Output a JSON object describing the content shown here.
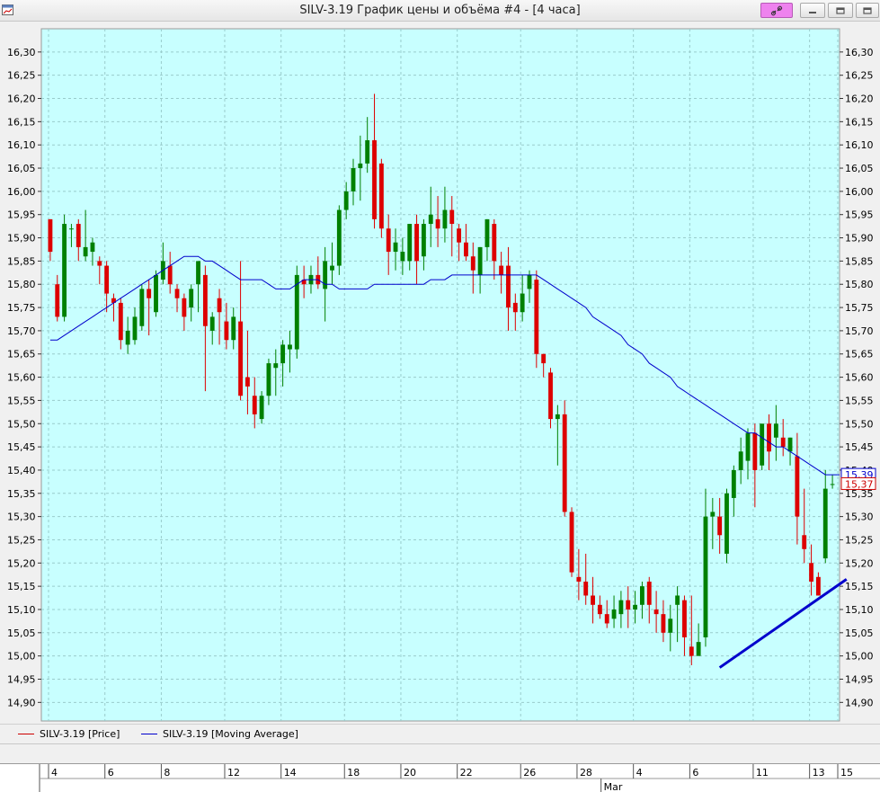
{
  "window": {
    "title": "SILV-3.19 График цены и объёма #4 - [4 часа]"
  },
  "legend": {
    "price_label": "SILV-3.19 [Price]",
    "ma_label": "SILV-3.19 [Moving Average]",
    "price_color": "#cc0000",
    "ma_color": "#0000cc"
  },
  "icons": {
    "app": "chart-window-icon",
    "link": "link-icon",
    "min": "minimize-icon",
    "max": "restore-icon",
    "close": "close-icon"
  },
  "colors": {
    "plot_bg": "#c8ffff",
    "bull": "#008000",
    "bear": "#dd0000",
    "trendline": "#0000cc",
    "ma": "#0000cc"
  },
  "chart_data": {
    "type": "candlestick",
    "y_axis": {
      "min": 14.86,
      "max": 16.35,
      "step": 0.05,
      "side": "both",
      "decimal_separator": ","
    },
    "current_price_labels": [
      {
        "value": 15.39,
        "text": "15,39",
        "color": "#0000cc"
      },
      {
        "value": 15.37,
        "text": "15,37",
        "color": "#cc0000"
      }
    ],
    "grid": true,
    "x_ticks": [
      "4",
      "6",
      "8",
      "12",
      "14",
      "18",
      "20",
      "22",
      "26",
      "28",
      "4",
      "6",
      "11",
      "13",
      "15"
    ],
    "x_month_label": "Mar",
    "series": [
      {
        "name": "SILV-3.19 [Price]",
        "kind": "ohlc",
        "values": [
          [
            15.94,
            15.94,
            15.85,
            15.87
          ],
          [
            15.8,
            15.82,
            15.72,
            15.73
          ],
          [
            15.73,
            15.95,
            15.72,
            15.93
          ],
          [
            15.92,
            15.93,
            15.88,
            15.92
          ],
          [
            15.93,
            15.94,
            15.85,
            15.88
          ],
          [
            15.86,
            15.96,
            15.85,
            15.88
          ],
          [
            15.87,
            15.9,
            15.84,
            15.89
          ],
          [
            15.85,
            15.86,
            15.8,
            15.84
          ],
          [
            15.84,
            15.85,
            15.74,
            15.78
          ],
          [
            15.77,
            15.78,
            15.72,
            15.76
          ],
          [
            15.76,
            15.77,
            15.66,
            15.68
          ],
          [
            15.67,
            15.73,
            15.65,
            15.7
          ],
          [
            15.68,
            15.75,
            15.67,
            15.73
          ],
          [
            15.71,
            15.8,
            15.7,
            15.79
          ],
          [
            15.79,
            15.81,
            15.69,
            15.77
          ],
          [
            15.74,
            15.83,
            15.73,
            15.82
          ],
          [
            15.81,
            15.89,
            15.8,
            15.85
          ],
          [
            15.84,
            15.87,
            15.78,
            15.8
          ],
          [
            15.79,
            15.8,
            15.74,
            15.77
          ],
          [
            15.77,
            15.78,
            15.7,
            15.73
          ],
          [
            15.75,
            15.8,
            15.72,
            15.79
          ],
          [
            15.8,
            15.84,
            15.74,
            15.85
          ],
          [
            15.82,
            15.84,
            15.57,
            15.71
          ],
          [
            15.7,
            15.74,
            15.67,
            15.73
          ],
          [
            15.77,
            15.79,
            15.67,
            15.74
          ],
          [
            15.72,
            15.76,
            15.66,
            15.68
          ],
          [
            15.68,
            15.75,
            15.66,
            15.73
          ],
          [
            15.72,
            15.85,
            15.55,
            15.56
          ],
          [
            15.6,
            15.7,
            15.52,
            15.58
          ],
          [
            15.56,
            15.6,
            15.49,
            15.52
          ],
          [
            15.51,
            15.57,
            15.5,
            15.56
          ],
          [
            15.56,
            15.64,
            15.54,
            15.63
          ],
          [
            15.62,
            15.66,
            15.56,
            15.63
          ],
          [
            15.63,
            15.68,
            15.58,
            15.67
          ],
          [
            15.66,
            15.7,
            15.61,
            15.67
          ],
          [
            15.66,
            15.84,
            15.64,
            15.82
          ],
          [
            15.81,
            15.84,
            15.77,
            15.8
          ],
          [
            15.8,
            15.84,
            15.78,
            15.82
          ],
          [
            15.82,
            15.86,
            15.79,
            15.8
          ],
          [
            15.79,
            15.88,
            15.72,
            15.85
          ],
          [
            15.83,
            15.89,
            15.8,
            15.84
          ],
          [
            15.84,
            15.97,
            15.82,
            15.96
          ],
          [
            15.96,
            16.02,
            15.94,
            16.0
          ],
          [
            16.0,
            16.07,
            15.97,
            16.05
          ],
          [
            16.05,
            16.12,
            15.98,
            16.06
          ],
          [
            16.06,
            16.16,
            16.04,
            16.11
          ],
          [
            16.11,
            16.21,
            15.92,
            15.94
          ],
          [
            16.06,
            16.07,
            15.9,
            15.92
          ],
          [
            15.92,
            15.95,
            15.82,
            15.87
          ],
          [
            15.87,
            15.92,
            15.83,
            15.89
          ],
          [
            15.85,
            15.9,
            15.82,
            15.87
          ],
          [
            15.85,
            15.93,
            15.83,
            15.93
          ],
          [
            15.93,
            15.95,
            15.8,
            15.85
          ],
          [
            15.86,
            15.94,
            15.83,
            15.93
          ],
          [
            15.93,
            16.01,
            15.88,
            15.95
          ],
          [
            15.94,
            15.99,
            15.88,
            15.92
          ],
          [
            15.92,
            16.01,
            15.89,
            15.96
          ],
          [
            15.96,
            15.99,
            15.86,
            15.93
          ],
          [
            15.92,
            15.93,
            15.85,
            15.89
          ],
          [
            15.89,
            15.93,
            15.85,
            15.86
          ],
          [
            15.86,
            15.89,
            15.78,
            15.83
          ],
          [
            15.82,
            15.88,
            15.78,
            15.88
          ],
          [
            15.88,
            15.94,
            15.85,
            15.94
          ],
          [
            15.93,
            15.94,
            15.81,
            15.85
          ],
          [
            15.84,
            15.87,
            15.78,
            15.82
          ],
          [
            15.84,
            15.88,
            15.7,
            15.75
          ],
          [
            15.76,
            15.78,
            15.7,
            15.74
          ],
          [
            15.74,
            15.82,
            15.72,
            15.78
          ],
          [
            15.79,
            15.83,
            15.76,
            15.82
          ],
          [
            15.81,
            15.83,
            15.62,
            15.65
          ],
          [
            15.65,
            15.65,
            15.6,
            15.63
          ],
          [
            15.61,
            15.62,
            15.49,
            15.51
          ],
          [
            15.51,
            15.54,
            15.41,
            15.52
          ],
          [
            15.52,
            15.55,
            15.3,
            15.31
          ],
          [
            15.31,
            15.32,
            15.17,
            15.18
          ],
          [
            15.17,
            15.23,
            15.12,
            15.16
          ],
          [
            15.16,
            15.22,
            15.11,
            15.13
          ],
          [
            15.13,
            15.17,
            15.07,
            15.11
          ],
          [
            15.11,
            15.13,
            15.08,
            15.09
          ],
          [
            15.09,
            15.12,
            15.06,
            15.07
          ],
          [
            15.08,
            15.13,
            15.06,
            15.1
          ],
          [
            15.09,
            15.14,
            15.06,
            15.12
          ],
          [
            15.12,
            15.15,
            15.06,
            15.1
          ],
          [
            15.1,
            15.14,
            15.07,
            15.11
          ],
          [
            15.11,
            15.16,
            15.08,
            15.15
          ],
          [
            15.16,
            15.17,
            15.07,
            15.11
          ],
          [
            15.1,
            15.14,
            15.05,
            15.09
          ],
          [
            15.09,
            15.12,
            15.03,
            15.05
          ],
          [
            15.05,
            15.11,
            15.01,
            15.08
          ],
          [
            15.11,
            15.15,
            15.03,
            15.13
          ],
          [
            15.12,
            15.13,
            15.0,
            15.04
          ],
          [
            15.02,
            15.13,
            14.98,
            15.0
          ],
          [
            15.0,
            15.07,
            15.0,
            15.03
          ],
          [
            15.04,
            15.36,
            15.02,
            15.3
          ],
          [
            15.3,
            15.34,
            15.23,
            15.31
          ],
          [
            15.3,
            15.34,
            15.22,
            15.26
          ],
          [
            15.22,
            15.36,
            15.2,
            15.35
          ],
          [
            15.34,
            15.41,
            15.3,
            15.4
          ],
          [
            15.4,
            15.47,
            15.37,
            15.44
          ],
          [
            15.42,
            15.49,
            15.38,
            15.48
          ],
          [
            15.48,
            15.5,
            15.32,
            15.4
          ],
          [
            15.41,
            15.49,
            15.4,
            15.5
          ],
          [
            15.5,
            15.52,
            15.4,
            15.44
          ],
          [
            15.47,
            15.54,
            15.42,
            15.5
          ],
          [
            15.47,
            15.51,
            15.43,
            15.45
          ],
          [
            15.44,
            15.47,
            15.41,
            15.47
          ],
          [
            15.43,
            15.48,
            15.24,
            15.3
          ],
          [
            15.26,
            15.36,
            15.2,
            15.23
          ],
          [
            15.2,
            15.24,
            15.13,
            15.16
          ],
          [
            15.17,
            15.18,
            15.13,
            15.13
          ],
          [
            15.21,
            15.4,
            15.2,
            15.36
          ],
          [
            15.37,
            15.39,
            15.36,
            15.37
          ]
        ]
      },
      {
        "name": "SILV-3.19 [Moving Average]",
        "kind": "line",
        "values": [
          15.68,
          15.68,
          15.69,
          15.7,
          15.71,
          15.72,
          15.73,
          15.74,
          15.75,
          15.76,
          15.77,
          15.78,
          15.79,
          15.8,
          15.81,
          15.82,
          15.83,
          15.84,
          15.85,
          15.86,
          15.86,
          15.86,
          15.85,
          15.85,
          15.84,
          15.83,
          15.82,
          15.81,
          15.81,
          15.81,
          15.81,
          15.8,
          15.79,
          15.79,
          15.79,
          15.8,
          15.81,
          15.81,
          15.81,
          15.8,
          15.8,
          15.79,
          15.79,
          15.79,
          15.79,
          15.79,
          15.8,
          15.8,
          15.8,
          15.8,
          15.8,
          15.8,
          15.8,
          15.8,
          15.81,
          15.81,
          15.81,
          15.82,
          15.82,
          15.82,
          15.82,
          15.82,
          15.82,
          15.82,
          15.82,
          15.82,
          15.82,
          15.82,
          15.82,
          15.82,
          15.81,
          15.8,
          15.79,
          15.78,
          15.77,
          15.76,
          15.75,
          15.73,
          15.72,
          15.71,
          15.7,
          15.69,
          15.67,
          15.66,
          15.65,
          15.63,
          15.62,
          15.61,
          15.6,
          15.58,
          15.57,
          15.56,
          15.55,
          15.54,
          15.53,
          15.52,
          15.51,
          15.5,
          15.49,
          15.48,
          15.48,
          15.47,
          15.46,
          15.45,
          15.45,
          15.44,
          15.43,
          15.42,
          15.41,
          15.4,
          15.39,
          15.39,
          15.39
        ]
      }
    ],
    "trendline": {
      "from": [
        95,
        14.975
      ],
      "to": [
        113,
        15.165
      ]
    }
  }
}
